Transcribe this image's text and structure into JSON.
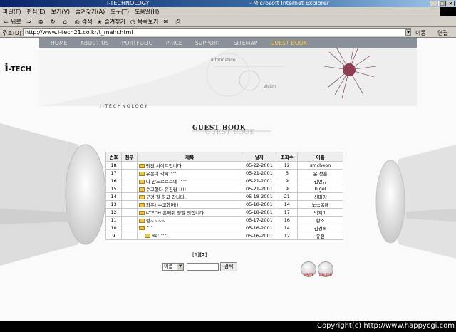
{
  "window": {
    "title_left": "I-TECHNOLOGY",
    "title_right": "- Microsoft Internet Explorer"
  },
  "menu": [
    "파일(F)",
    "편집(E)",
    "보기(V)",
    "즐겨찾기(A)",
    "도구(T)",
    "도움말(H)"
  ],
  "toolbar": {
    "back": "뒤로",
    "search": "검색",
    "favorites": "즐겨찾기",
    "history": "목록보기"
  },
  "address": {
    "label": "주소(D)",
    "url": "http://www.i-tech21.co.kr/t_main.html",
    "go": "이동",
    "links": "연결"
  },
  "nav": [
    "HOME",
    "ABOUT US",
    "PORTFOLIO",
    "PRICE",
    "SUPPORT",
    "SITEMAP",
    "GUEST BOOK"
  ],
  "banner": {
    "logo": "i",
    "logo_text": "-TECH",
    "tagline": "I-TECHNOLOGY",
    "information": "information",
    "vision": "vision"
  },
  "guestbook": {
    "title": "GUEST BOOK",
    "headers": [
      "번호",
      "첨부",
      "제목",
      "날자",
      "조회수",
      "이름"
    ],
    "rows": [
      {
        "no": "18",
        "subject": "멋진 사이트입니다.",
        "date": "05-22-2001",
        "views": "12",
        "name": "smcheon",
        "reply": false
      },
      {
        "no": "17",
        "subject": "우홍이 각시^^",
        "date": "05-21-2001",
        "views": "6",
        "name": "윤 정훈",
        "reply": false
      },
      {
        "no": "16",
        "subject": "다 만드르르르네 ^^",
        "date": "05-21-2001",
        "views": "9",
        "name": "김연규",
        "reply": false
      },
      {
        "no": "15",
        "subject": "수고했다 유진랑 !!!!",
        "date": "05-21-2001",
        "views": "9",
        "name": "higel",
        "reply": false
      },
      {
        "no": "14",
        "subject": "구경 잘 하고 갑니다.",
        "date": "05-18-2001",
        "views": "21",
        "name": "신미양",
        "reply": false
      },
      {
        "no": "13",
        "subject": "와우! 수고했어!!",
        "date": "05-18-2001",
        "views": "14",
        "name": "노숙봄매",
        "reply": false
      },
      {
        "no": "12",
        "subject": "I-TECH 홈페쥐 정말 멋집니다.",
        "date": "05-18-2001",
        "views": "17",
        "name": "박지미",
        "reply": false
      },
      {
        "no": "11",
        "subject": "헝~~~~",
        "date": "05-17-2001",
        "views": "16",
        "name": "황조",
        "reply": false
      },
      {
        "no": "10",
        "subject": "^^",
        "date": "05-16-2001",
        "views": "14",
        "name": "김경록",
        "reply": false
      },
      {
        "no": "9",
        "subject": "Re: ^^",
        "date": "05-16-2001",
        "views": "12",
        "name": "유진",
        "reply": true
      }
    ],
    "pager": "[1]",
    "pager_current": "[2]",
    "search_option": "이름",
    "search_button": "검색",
    "write_label": "WRITE",
    "delete_label": "DELEDD"
  },
  "footer": {
    "copyright": "Copyright(c) http://www.happycgi.com"
  }
}
